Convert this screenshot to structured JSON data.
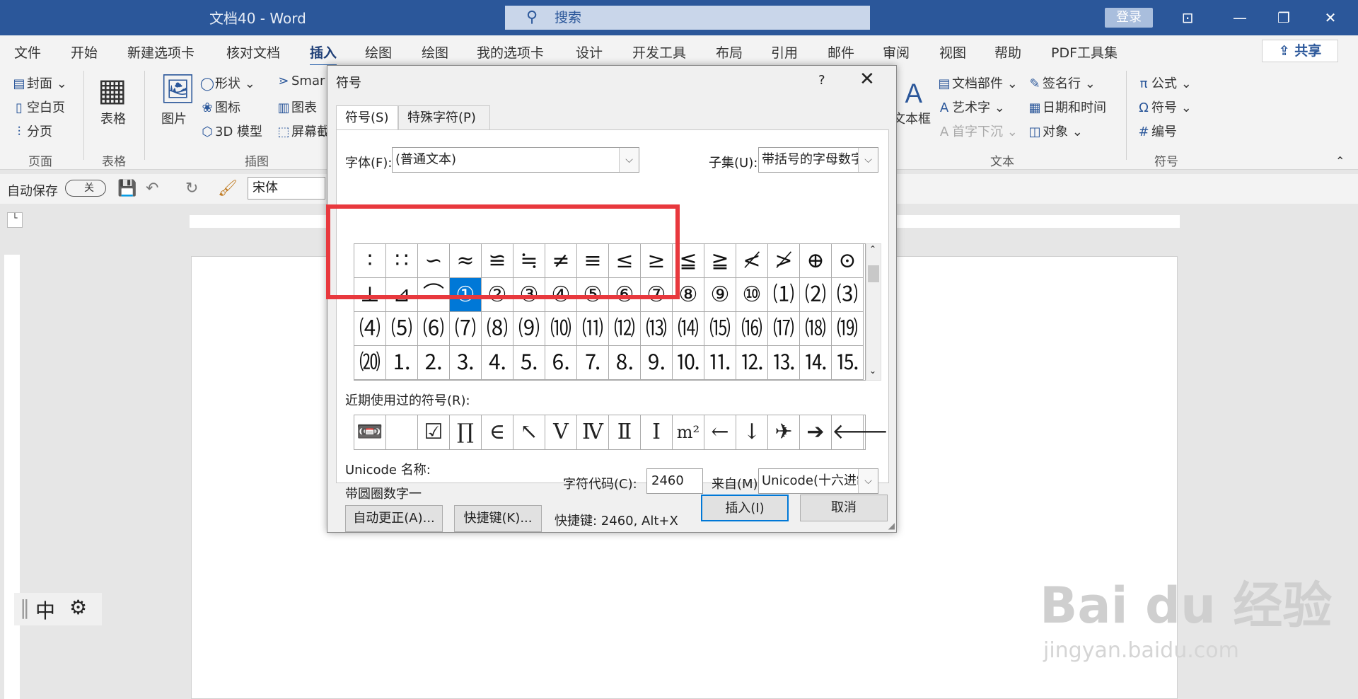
{
  "titlebar": {
    "title": "文档40  -  Word",
    "search": "搜索",
    "login": "登录"
  },
  "menu": {
    "tabs": [
      "文件",
      "开始",
      "新建选项卡",
      "核对文档",
      "插入",
      "绘图",
      "绘图",
      "我的选项卡",
      "设计",
      "开发工具",
      "布局",
      "引用",
      "邮件",
      "审阅",
      "视图",
      "帮助",
      "PDF工具集"
    ],
    "share": "共享"
  },
  "ribbon": {
    "pages": [
      "封面",
      "空白页",
      "分页"
    ],
    "pages_label": "页面",
    "table": "表格",
    "table_label": "表格",
    "picture": "图片",
    "shapes": "形状",
    "icons": "图标",
    "model3d": "3D 模型",
    "smartart": "Smar",
    "chart": "图表",
    "screenshot": "屏幕截",
    "illus_label": "插图",
    "textbox": "文本框",
    "quickparts": "文档部件",
    "wordart": "艺术字",
    "dropcap": "首字下沉",
    "signature": "签名行",
    "datetime": "日期和时间",
    "object": "对象",
    "text_label": "文本",
    "equation": "公式",
    "symbol": "符号",
    "number": "编号",
    "symbols_label": "符号"
  },
  "qat": {
    "autosave": "自动保存",
    "toggle": "关",
    "font": "宋体"
  },
  "ime": {
    "lang": "中"
  },
  "watermark": {
    "line1": "Bai du 经验",
    "line2": "jingyan.baidu.com"
  },
  "dialog": {
    "title": "符号",
    "help": "?",
    "tabs": [
      "符号(S)",
      "特殊字符(P)"
    ],
    "font_label": "字体(F):",
    "font_value": "(普通文本)",
    "subset_label": "子集(U):",
    "subset_value": "带括号的字母数字",
    "grid": [
      [
        "∶",
        "∷",
        "∽",
        "≈",
        "≌",
        "≒",
        "≠",
        "≡",
        "≤",
        "≥",
        "≦",
        "≧",
        "≮",
        "≯",
        "⊕",
        "⊙"
      ],
      [
        "⊥",
        "⊿",
        "⌒",
        "①",
        "②",
        "③",
        "④",
        "⑤",
        "⑥",
        "⑦",
        "⑧",
        "⑨",
        "⑩",
        "⑴",
        "⑵",
        "⑶"
      ],
      [
        "⑷",
        "⑸",
        "⑹",
        "⑺",
        "⑻",
        "⑼",
        "⑽",
        "⑾",
        "⑿",
        "⒀",
        "⒁",
        "⒂",
        "⒃",
        "⒄",
        "⒅",
        "⒆"
      ],
      [
        "⒇",
        "⒈",
        "⒉",
        "⒊",
        "⒋",
        "⒌",
        "⒍",
        "⒎",
        "⒏",
        "⒐",
        "⒑",
        "⒒",
        "⒓",
        "⒔",
        "⒕",
        "⒖"
      ]
    ],
    "recent_label": "近期使用过的符号(R):",
    "recent": [
      "📼",
      " ",
      "☑",
      "∏",
      "∈",
      "↖",
      "Ⅴ",
      "Ⅳ",
      "Ⅱ",
      "Ⅰ",
      "m²",
      "←",
      "↓",
      "✈",
      "➔",
      "🡐"
    ],
    "unicode_name_label": "Unicode 名称:",
    "unicode_name": "带圆圈数字一",
    "charcode_label": "字符代码(C):",
    "charcode": "2460",
    "from_label": "来自(M):",
    "from_value": "Unicode(十六进制)",
    "autocorrect": "自动更正(A)...",
    "shortcut_btn": "快捷键(K)...",
    "shortcut_text": "快捷键: 2460, Alt+X",
    "insert": "插入(I)",
    "cancel": "取消"
  }
}
